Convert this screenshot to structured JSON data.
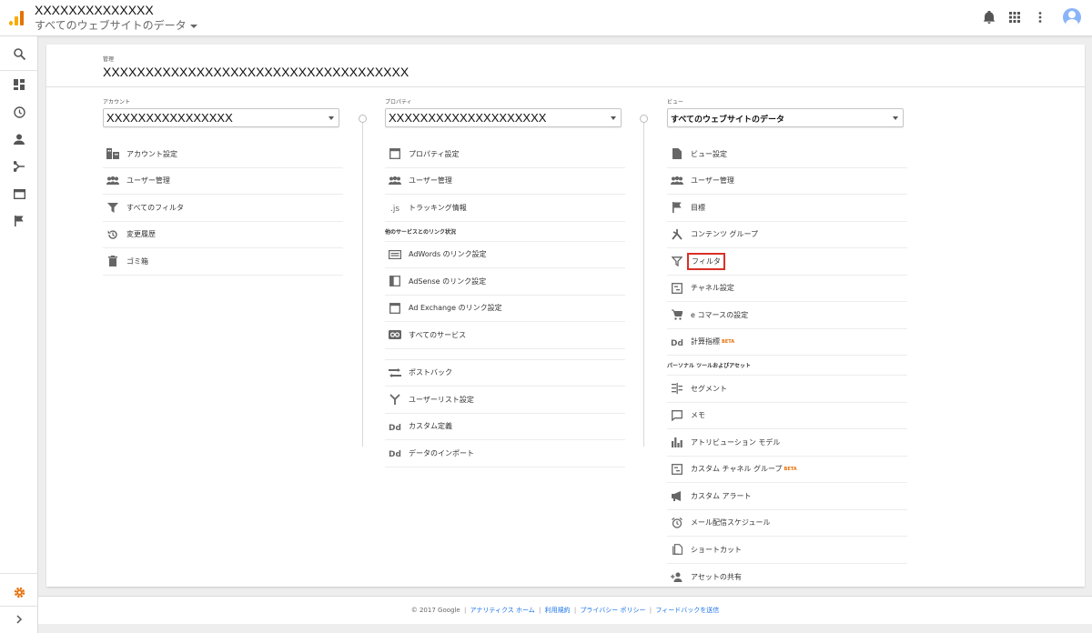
{
  "header": {
    "account_name": "XXXXXXXXXXXXXX",
    "property_view": "すべてのウェブサイトのデータ"
  },
  "admin": {
    "label": "管理",
    "title": "XXXXXXXXXXXXXXXXXXXXXXXXXXXXXXXXXXXX"
  },
  "account": {
    "label": "アカウント",
    "selected": "XXXXXXXXXXXXXXXX",
    "items": [
      "アカウント設定",
      "ユーザー管理",
      "すべてのフィルタ",
      "変更履歴",
      "ゴミ箱"
    ]
  },
  "property": {
    "label": "プロパティ",
    "selected": "XXXXXXXXXXXXXXXXXXXX",
    "items": [
      "プロパティ設定",
      "ユーザー管理",
      "トラッキング情報"
    ],
    "section_links": "他のサービスとのリンク状況",
    "link_items": [
      "AdWords のリンク設定",
      "AdSense のリンク設定",
      "Ad Exchange のリンク設定",
      "すべてのサービス"
    ],
    "more_items": [
      "ポストバック",
      "ユーザーリスト設定",
      "カスタム定義",
      "データのインポート"
    ]
  },
  "view": {
    "label": "ビュー",
    "selected": "すべてのウェブサイトのデータ",
    "items": [
      "ビュー設定",
      "ユーザー管理",
      "目標",
      "コンテンツ グループ",
      "フィルタ",
      "チャネル設定",
      "e コマースの設定",
      "計算指標"
    ],
    "beta": "BETA",
    "section_personal": "パーソナル ツールおよびアセット",
    "personal_items": [
      "セグメント",
      "メモ",
      "アトリビューション モデル",
      "カスタム チャネル グループ",
      "カスタム アラート",
      "メール配信スケジュール",
      "ショートカット",
      "アセットの共有"
    ]
  },
  "footer": {
    "copyright": "© 2017 Google",
    "links": [
      "アナリティクス ホーム",
      "利用規約",
      "プライバシー ポリシー",
      "フィードバックを送信"
    ]
  },
  "colors": {
    "accent_orange": "#e8710a",
    "highlight_red": "#d93025",
    "link_blue": "#1a73e8"
  }
}
